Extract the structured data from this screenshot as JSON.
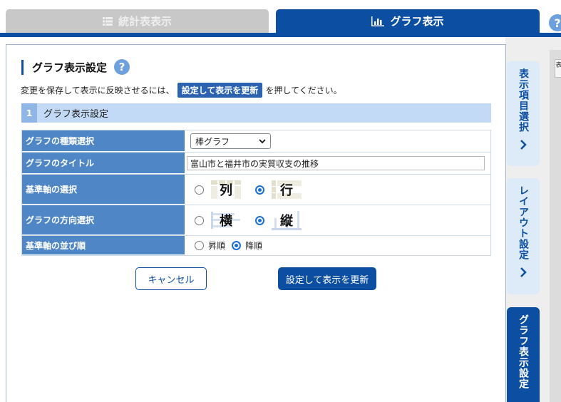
{
  "tabs": {
    "stats_label": "統計表表示",
    "graph_label": "グラフ表示"
  },
  "help_top": "?",
  "side_tabs": {
    "items_label": "表示項目選択",
    "layout_label": "レイアウト設定",
    "graph_label": "グラフ表示設定",
    "chevron": "›",
    "strip_label": "表"
  },
  "panel": {
    "title": "グラフ表示設定",
    "help": "?",
    "instruction_before": "変更を保存して表示に反映させるには、",
    "instruction_pill": "設定して表示を更新",
    "instruction_after": "を押してください。",
    "section_number": "1",
    "section_title": "グラフ表示設定"
  },
  "form": {
    "chart_type_label": "グラフの種類選択",
    "chart_type_value": "棒グラフ",
    "title_label": "グラフのタイトル",
    "title_value": "富山市と福井市の実質収支の推移",
    "axis_label": "基準軸の選択",
    "axis_option_col": "列",
    "axis_option_row": "行",
    "axis_selected": "行",
    "direction_label": "グラフの方向選択",
    "direction_option_h": "横",
    "direction_option_v": "縦",
    "direction_selected": "縦",
    "order_label": "基準軸の並び順",
    "order_asc": "昇順",
    "order_desc": "降順",
    "order_selected": "降順"
  },
  "buttons": {
    "cancel": "キャンセル",
    "update": "設定して表示を更新"
  },
  "colors": {
    "primary": "#0b4ea2",
    "label_bg": "#4f86c6",
    "section_bg": "#c2daf5",
    "inactive_tab": "#c8c8c8"
  }
}
